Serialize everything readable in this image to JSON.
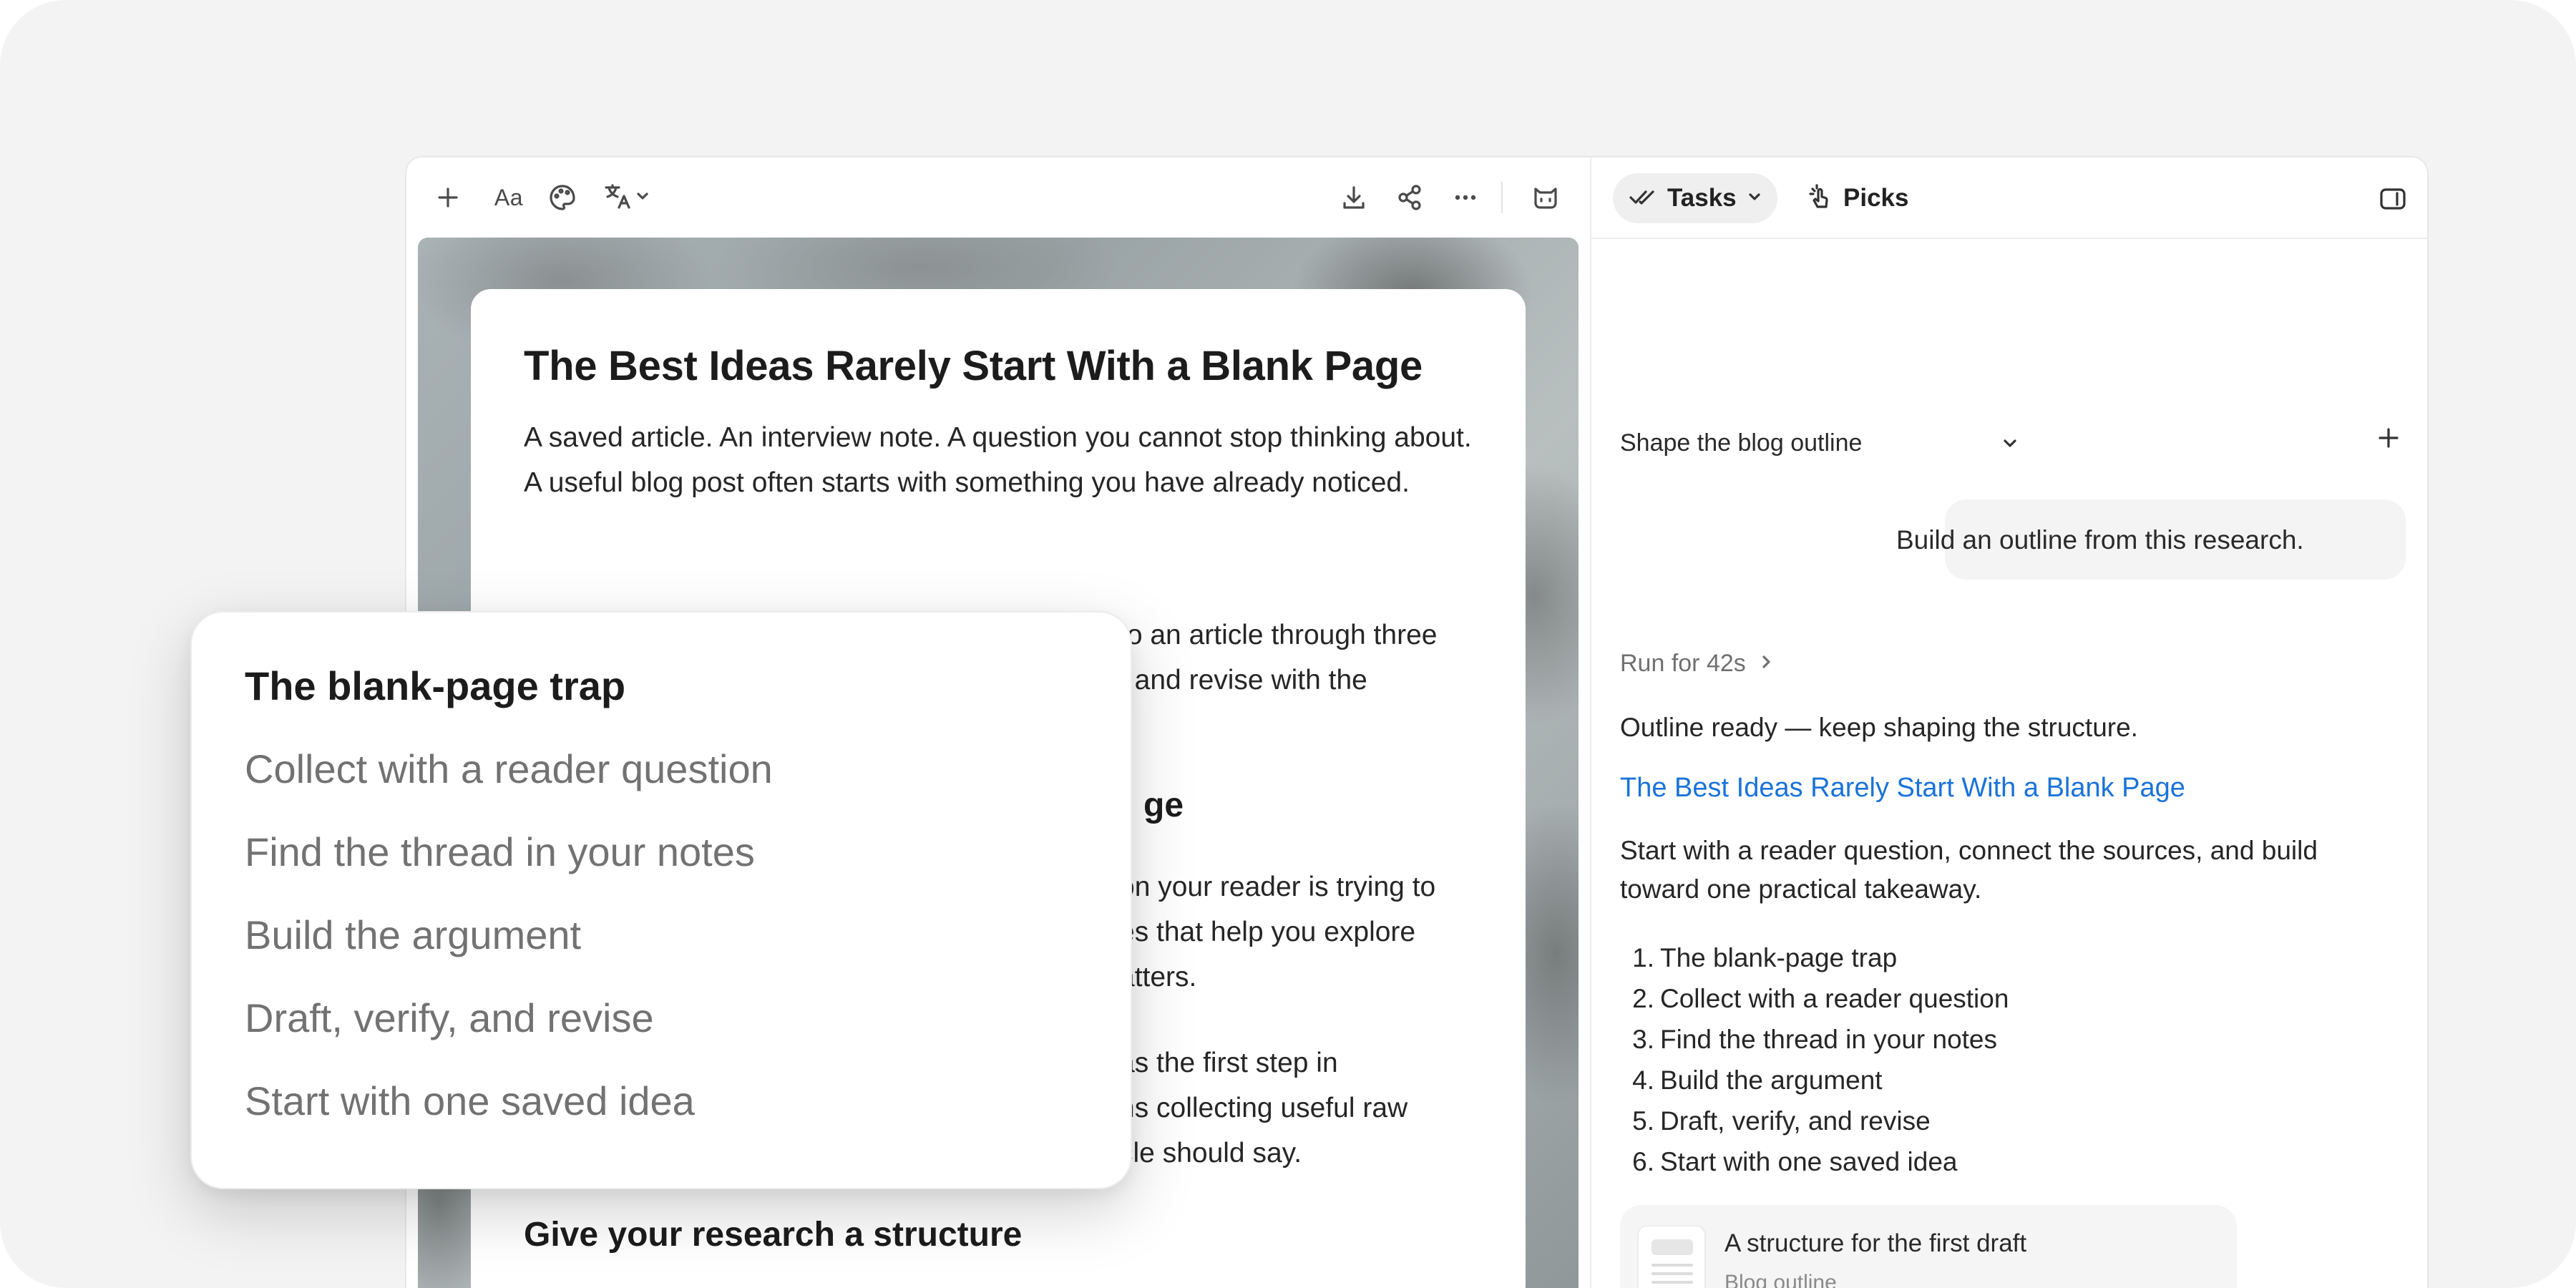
{
  "editor": {
    "toolbar": {
      "add_icon": "plus-icon",
      "font_label": "Aa",
      "palette_icon": "palette-icon",
      "translate_icon": "translate-icon",
      "download_icon": "download-icon",
      "share_icon": "share-icon",
      "more_icon": "more-icon",
      "assistant_icon": "assistant-icon"
    },
    "document": {
      "title": "The Best Ideas Rarely Start With a Blank Page",
      "paragraphs": [
        "A saved article. An interview note. A question you cannot stop thinking about. A useful blog post often starts with something you have already noticed.",
        "to an article through three\n, and revise with the"
      ],
      "heading_partial": "ge",
      "paragraph_partial_1": "on your reader is trying to\nes that help you explore\natters.",
      "paragraph_partial_2": "as the first step in\nns collecting useful raw\ncle should say.",
      "heading_2": "Give your research a structure"
    }
  },
  "outline_card": {
    "items": [
      "The blank-page trap",
      "Collect with a reader question",
      "Find the thread in your notes",
      "Build the argument",
      "Draft, verify, and revise",
      "Start with one saved idea"
    ]
  },
  "assistant": {
    "tabs": [
      {
        "label": "Tasks",
        "icon": "double-check-icon"
      },
      {
        "label": "Picks",
        "icon": "pointer-click-icon"
      }
    ],
    "task_title": "Shape the blog outline",
    "user_message": "Build an outline from this research.",
    "run_label": "Run for 42s",
    "status_text": "Outline ready — keep shaping the structure.",
    "link_text": "The Best Ideas Rarely Start With a Blank Page",
    "summary": "Start with a reader question, connect the sources, and build toward one practical takeaway.",
    "outline": [
      {
        "num": "1.",
        "text": "The blank-page trap"
      },
      {
        "num": "2.",
        "text": "Collect with a reader question"
      },
      {
        "num": "3.",
        "text": "Find the thread in your notes"
      },
      {
        "num": "4.",
        "text": "Build the argument"
      },
      {
        "num": "5.",
        "text": "Draft, verify, and revise"
      },
      {
        "num": "6.",
        "text": "Start with one saved idea"
      }
    ],
    "doc_card": {
      "title": "A structure for the first draft",
      "subtitle": "Blog outline"
    }
  },
  "colors": {
    "link": "#1a73d9",
    "backdrop": "#f3f3f3",
    "bubble": "#f4f4f4"
  }
}
